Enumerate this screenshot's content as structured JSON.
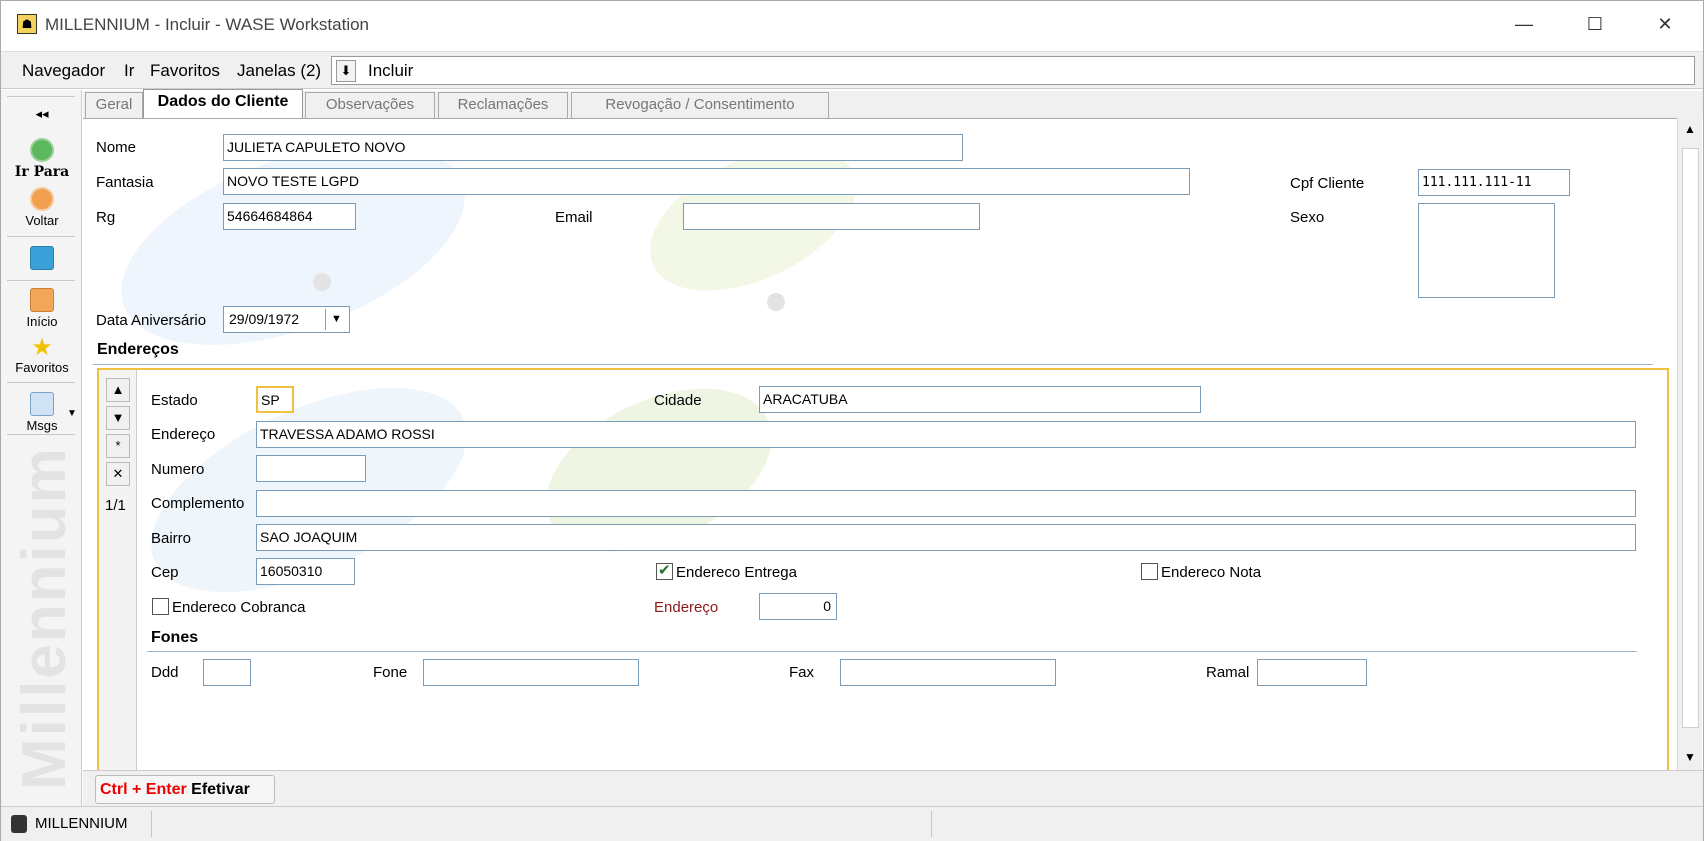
{
  "window": {
    "title": "MILLENNIUM - Incluir - WASE Workstation",
    "controls": {
      "minimize": "—",
      "maximize": "☐",
      "close": "✕"
    }
  },
  "menu": {
    "items": [
      {
        "label": "Navegador"
      },
      {
        "label": "Ir"
      },
      {
        "label": "Favoritos"
      },
      {
        "label": "Janelas (2)"
      }
    ],
    "command_value": "Incluir"
  },
  "nav": {
    "collapse": "◂◂",
    "items": [
      {
        "label": "Ir Para",
        "icon": "arrow-right-icon"
      },
      {
        "label": "Voltar",
        "icon": "arrow-left-icon"
      },
      {
        "label": "",
        "icon": "refresh-icon"
      },
      {
        "label": "Início",
        "icon": "home-icon"
      },
      {
        "label": "Favoritos",
        "icon": "star-icon"
      },
      {
        "label": "Msgs",
        "icon": "mail-icon"
      }
    ],
    "brand": "Millennium"
  },
  "tabs": [
    {
      "label": "Geral",
      "active": false
    },
    {
      "label": "Dados do Cliente",
      "active": true
    },
    {
      "label": "Observações",
      "active": false
    },
    {
      "label": "Reclamações",
      "active": false
    },
    {
      "label": "Revogação / Consentimento",
      "active": false
    }
  ],
  "client": {
    "nome_label": "Nome",
    "nome": "JULIETA CAPULETO NOVO",
    "fantasia_label": "Fantasia",
    "fantasia": "NOVO TESTE LGPD",
    "rg_label": "Rg",
    "rg": "54664684864",
    "email_label": "Email",
    "email": "",
    "cpf_label": "Cpf Cliente",
    "cpf": "111.111.111-11",
    "sexo_label": "Sexo",
    "sexo": "",
    "aniversario_label": "Data Aniversário",
    "aniversario": "29/09/1972"
  },
  "enderecos": {
    "title": "Endereços",
    "counter": "1/1",
    "estado_label": "Estado",
    "estado": "SP",
    "cidade_label": "Cidade",
    "cidade": "ARACATUBA",
    "endereco_label": "Endereço",
    "endereco": "TRAVESSA ADAMO ROSSI",
    "numero_label": "Numero",
    "numero": "",
    "complemento_label": "Complemento",
    "complemento": "",
    "bairro_label": "Bairro",
    "bairro": "SAO JOAQUIM",
    "cep_label": "Cep",
    "cep": "16050310",
    "entrega_label": "Endereco Entrega",
    "entrega_checked": true,
    "nota_label": "Endereco Nota",
    "nota_checked": false,
    "cobranca_label": "Endereco Cobranca",
    "cobranca_checked": false,
    "endereco_num_label": "Endereço",
    "endereco_num": "0"
  },
  "fones": {
    "title": "Fones",
    "ddd_label": "Ddd",
    "ddd": "",
    "fone_label": "Fone",
    "fone": "",
    "fax_label": "Fax",
    "fax": "",
    "ramal_label": "Ramal",
    "ramal": ""
  },
  "actions": {
    "shortcut": "Ctrl + Enter",
    "efetivar": "Efetivar"
  },
  "status": {
    "app": "MILLENNIUM"
  },
  "colors": {
    "accent_border": "#f0c040",
    "field_border": "#7a9cb8",
    "shortcut_red": "#e00000",
    "label_red": "#8b1a1a"
  }
}
